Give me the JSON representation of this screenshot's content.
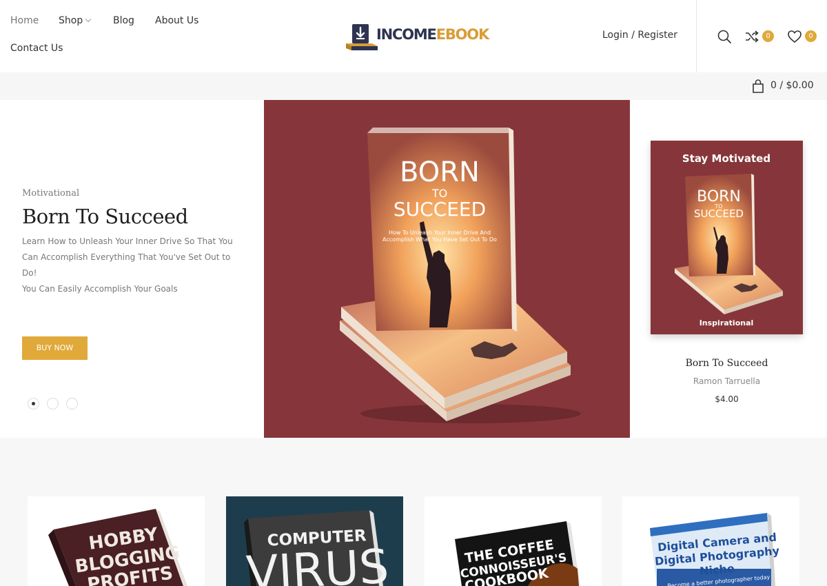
{
  "nav": {
    "home": "Home",
    "shop": "Shop",
    "blog": "Blog",
    "about": "About Us",
    "contact": "Contact Us"
  },
  "logo": {
    "part1": "INCOME",
    "part2": "EBOOK"
  },
  "header": {
    "login": "Login / Register",
    "compare_count": "0",
    "wishlist_count": "0"
  },
  "cart": {
    "summary": "0 / $0.00"
  },
  "hero": {
    "category": "Motivational",
    "title": "Born To Succeed",
    "description": "Learn How to Unleash Your Inner Drive So That You Can Accomplish Everything That You've Set Out to Do!",
    "description2": "You Can Easily Accomplish Your Goals",
    "button": "BUY NOW",
    "slide_count": 3,
    "active_slide": 1,
    "book_cover": {
      "title_line1": "BORN",
      "title_line2": "TO",
      "title_line3": "SUCCEED",
      "tagline_line1": "How To Unleash Your Inner Drive And",
      "tagline_line2": "Accomplish What You Have Set Out To Do"
    }
  },
  "side_product": {
    "card_header": "Stay Motivated",
    "card_footer": "Inspirational",
    "name": "Born To Succeed",
    "author": "Ramon Tarruella",
    "price": "$4.00"
  },
  "products": [
    {
      "cover_lines": [
        "HOBBY",
        "BLOGGING",
        "PROFITS"
      ]
    },
    {
      "cover_lines": [
        "COMPUTER",
        "VIRUS"
      ]
    },
    {
      "cover_lines": [
        "THE COFFEE",
        "CONNOISSEUR'S",
        "COOKBOOK"
      ]
    },
    {
      "cover_lines": [
        "Digital Camera and",
        "Digital Photography",
        "Niche"
      ],
      "tagline": "Become a better photographer today"
    }
  ],
  "colors": {
    "accent": "#e0a93a",
    "hero_bg": "#86363a",
    "logo_dark": "#2e3450",
    "logo_gold": "#d99c36"
  }
}
